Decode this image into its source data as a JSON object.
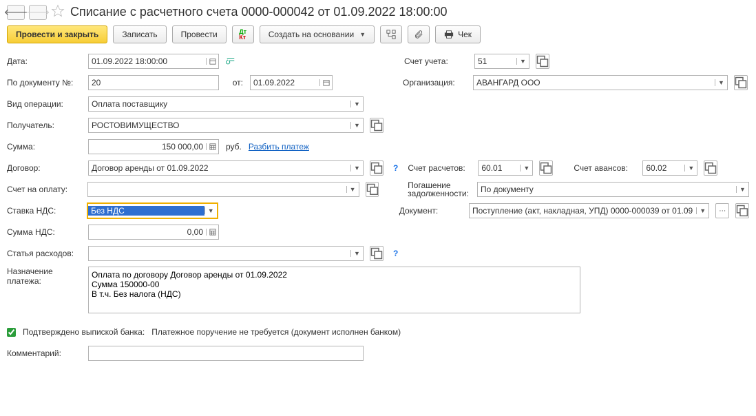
{
  "title": "Списание с расчетного счета 0000-000042 от 01.09.2022 18:00:00",
  "toolbar": {
    "post_close": "Провести и закрыть",
    "save": "Записать",
    "post": "Провести",
    "create_based": "Создать на основании",
    "cheque": "Чек"
  },
  "labels": {
    "date": "Дата:",
    "doc_no": "По документу №:",
    "from": "от:",
    "op_type": "Вид операции:",
    "recipient": "Получатель:",
    "amount": "Сумма:",
    "rub": "руб.",
    "split": "Разбить платеж",
    "contract": "Договор:",
    "invoice": "Счет на оплату:",
    "vat_rate": "Ставка НДС:",
    "vat_sum": "Сумма НДС:",
    "expense": "Статья расходов:",
    "purpose": "Назначение платежа:",
    "confirmed": "Подтверждено выпиской банка:",
    "confirmed_text": "Платежное поручение не требуется (документ исполнен банком)",
    "comment": "Комментарий:",
    "account": "Счет учета:",
    "org": "Организация:",
    "settle_acc": "Счет расчетов:",
    "advance_acc": "Счет авансов:",
    "debt": "Погашение задолженности:",
    "document": "Документ:"
  },
  "values": {
    "date": "01.09.2022 18:00:00",
    "doc_no": "20",
    "from": "01.09.2022",
    "op_type": "Оплата поставщику",
    "recipient": "РОСТОВИМУЩЕСТВО",
    "amount": "150 000,00",
    "contract": "Договор аренды от 01.09.2022",
    "invoice": "",
    "vat_rate": "Без НДС",
    "vat_sum": "0,00",
    "expense": "",
    "purpose": "Оплата по договору Договор аренды от 01.09.2022\nСумма 150000-00\nВ т.ч. Без налога (НДС)",
    "comment": "",
    "account": "51",
    "org": "АВАНГАРД ООО",
    "settle_acc": "60.01",
    "advance_acc": "60.02",
    "debt": "По документу",
    "document": "Поступление (акт, накладная, УПД) 0000-000039 от 01.09"
  }
}
